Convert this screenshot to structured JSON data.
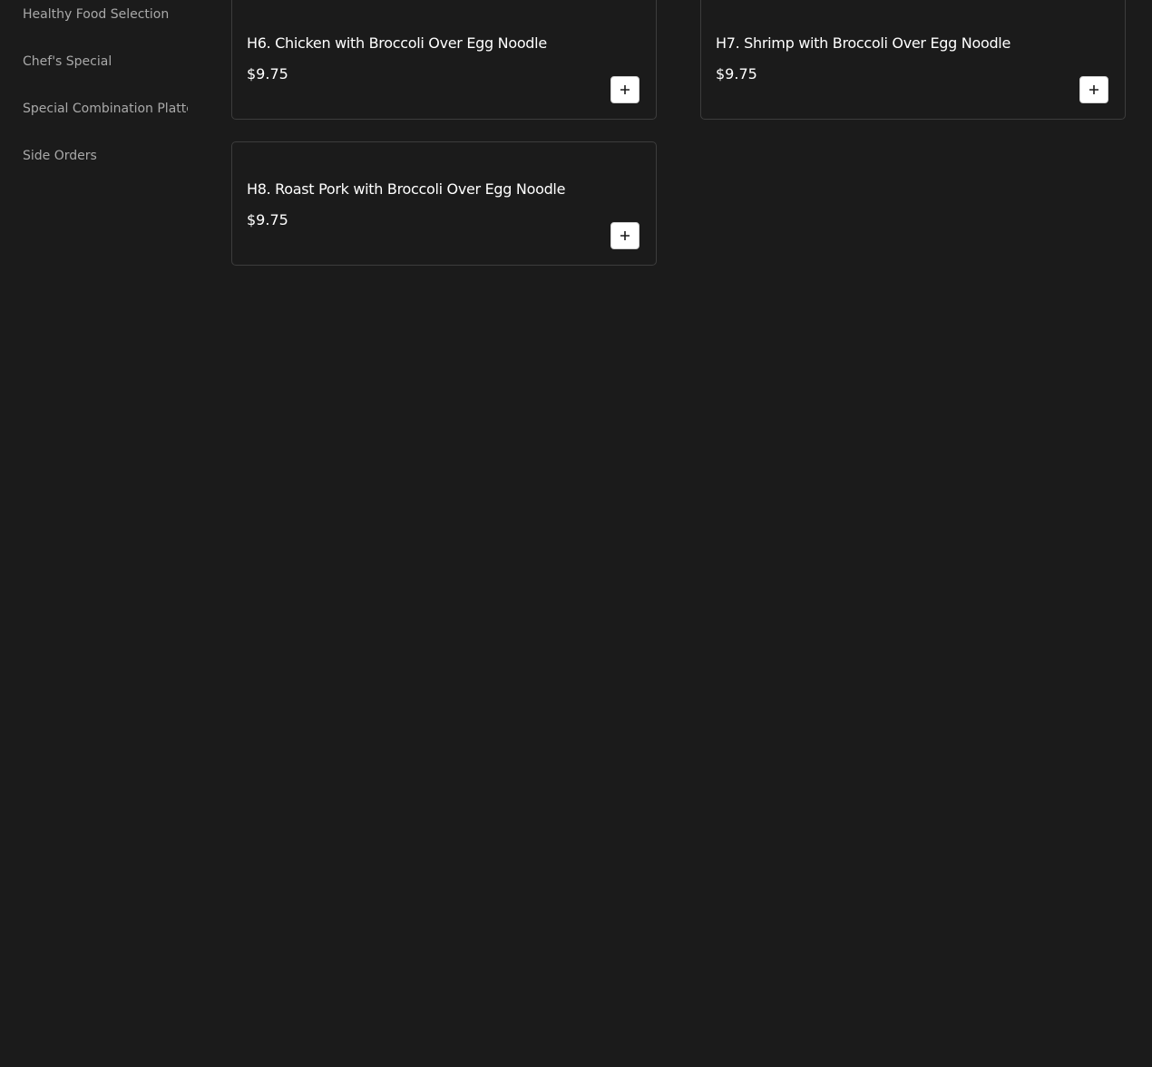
{
  "sidebar": {
    "items": [
      {
        "label": "Healthy Food Selection"
      },
      {
        "label": "Chef's Special"
      },
      {
        "label": "Special Combination Platters"
      },
      {
        "label": "Side Orders"
      }
    ]
  },
  "menu": {
    "items": [
      {
        "name": "H6. Chicken with Broccoli Over Egg Noodle",
        "price": "$9.75",
        "add_icon": "plus-icon"
      },
      {
        "name": "H7. Shrimp with Broccoli Over Egg Noodle",
        "price": "$9.75",
        "add_icon": "plus-icon"
      },
      {
        "name": "H8. Roast Pork with Broccoli Over Egg Noodle",
        "price": "$9.75",
        "add_icon": "plus-icon"
      }
    ]
  },
  "colors": {
    "background": "#1b1b1b",
    "card_border": "#3d3d3d",
    "text_primary": "#ffffff",
    "text_secondary": "#a9a9a9",
    "button_bg": "#ffffff"
  }
}
